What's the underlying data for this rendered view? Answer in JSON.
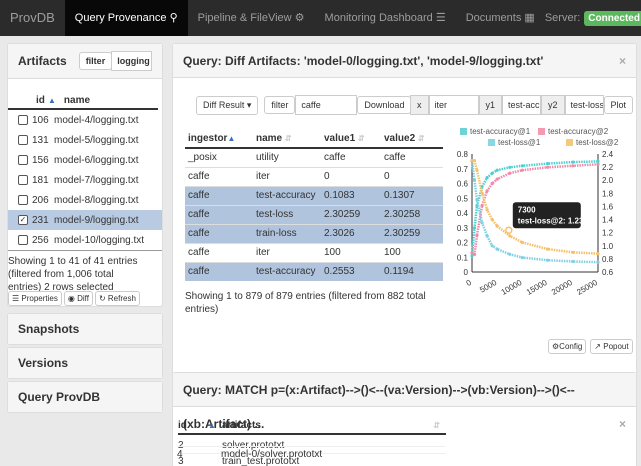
{
  "navbar": {
    "brand": "ProvDB",
    "items": [
      {
        "label": "Query Provenance",
        "icon": "search-icon"
      },
      {
        "label": "Pipeline & FileView",
        "icon": "gear-icon"
      },
      {
        "label": "Monitoring Dashboard",
        "icon": "list-icon"
      },
      {
        "label": "Documents",
        "icon": "document-icon"
      }
    ],
    "server_label": "Server:",
    "server_status": "Connected"
  },
  "sidebar": {
    "artifacts": {
      "title": "Artifacts",
      "filter_label": "filter",
      "filter_value": "logging",
      "col_id": "id",
      "col_name": "name",
      "rows": [
        {
          "id": "106",
          "name": "model-4/logging.txt",
          "checked": false
        },
        {
          "id": "131",
          "name": "model-5/logging.txt",
          "checked": false
        },
        {
          "id": "156",
          "name": "model-6/logging.txt",
          "checked": false
        },
        {
          "id": "181",
          "name": "model-7/logging.txt",
          "checked": false
        },
        {
          "id": "206",
          "name": "model-8/logging.txt",
          "checked": false
        },
        {
          "id": "231",
          "name": "model-9/logging.txt",
          "checked": true
        },
        {
          "id": "256",
          "name": "model-10/logging.txt",
          "checked": false
        }
      ],
      "info_line1": "Showing 1 to 41 of 41 entries",
      "info_line2": "(filtered from 1,006 total",
      "info_line3": "entries)   2 rows selected",
      "btn_properties": "Properties",
      "btn_diff": "Diff",
      "btn_refresh": "Refresh"
    },
    "snapshots": "Snapshots",
    "versions": "Versions",
    "query_provdb": "Query ProvDB"
  },
  "diff_panel": {
    "title": "Query: Diff Artifacts: 'model-0/logging.txt', 'model-9/logging.txt'",
    "toolbar": {
      "diff_result": "Diff Result",
      "filter_label": "filter",
      "filter_value": "caffe",
      "download": "Download",
      "x_label": "x",
      "x_value": "iter",
      "y1_label": "y1",
      "y1_value": "test-acc",
      "y2_label": "y2",
      "y2_value": "test-loss",
      "plot": "Plot"
    },
    "table": {
      "headers": [
        "ingestor",
        "name",
        "value1",
        "value2"
      ],
      "rows": [
        {
          "ingestor": "_posix",
          "name": "utility",
          "value1": "caffe",
          "value2": "caffe",
          "hl": false
        },
        {
          "ingestor": "caffe",
          "name": "iter",
          "value1": "0",
          "value2": "0",
          "hl": false
        },
        {
          "ingestor": "caffe",
          "name": "test-accuracy",
          "value1": "0.1083",
          "value2": "0.1307",
          "hl": true
        },
        {
          "ingestor": "caffe",
          "name": "test-loss",
          "value1": "2.30259",
          "value2": "2.30258",
          "hl": true
        },
        {
          "ingestor": "caffe",
          "name": "train-loss",
          "value1": "2.3026",
          "value2": "2.30259",
          "hl": true
        },
        {
          "ingestor": "caffe",
          "name": "iter",
          "value1": "100",
          "value2": "100",
          "hl": false
        },
        {
          "ingestor": "caffe",
          "name": "test-accuracy",
          "value1": "0.2553",
          "value2": "0.1194",
          "hl": true
        }
      ],
      "info_line1": "Showing 1 to 879 of 879 entries (filtered from 882 total",
      "info_line2": "entries)"
    },
    "config": "Config",
    "popout": "Popout"
  },
  "match_panel": {
    "title": "Query: MATCH p=(x:Artifact)-->()<--(va:Version)-->(vb:Version)-->()<--(xb:Artifact) ...",
    "col_id": "id",
    "col_artifacts": "artifacts",
    "rows": [
      {
        "id": "2",
        "artifact": "solver.prototxt"
      },
      {
        "id": "3",
        "artifact": "train_test.prototxt"
      },
      {
        "id": "4",
        "artifact": "model-0/solver.prototxt"
      }
    ]
  },
  "chart_data": {
    "type": "line",
    "legend": [
      {
        "name": "test-accuracy@1",
        "color": "#6fd3d6"
      },
      {
        "name": "test-accuracy@2",
        "color": "#f19ab0"
      },
      {
        "name": "test-loss@1",
        "color": "#89d7e6"
      },
      {
        "name": "test-loss@2",
        "color": "#f6c87a"
      }
    ],
    "xlim": [
      0,
      25000
    ],
    "x_ticks": [
      "0",
      "5000",
      "10000",
      "15000",
      "20000",
      "25000"
    ],
    "y1lim": [
      0,
      0.8
    ],
    "y1_ticks": [
      "0",
      "0.1",
      "0.2",
      "0.3",
      "0.4",
      "0.5",
      "0.6",
      "0.7",
      "0.8"
    ],
    "y2lim": [
      0.6,
      2.4
    ],
    "y2_ticks": [
      "0.6",
      "0.8",
      "1.0",
      "1.2",
      "1.4",
      "1.6",
      "1.8",
      "2.0",
      "2.2",
      "2.4"
    ],
    "series": [
      {
        "name": "test-accuracy@1",
        "axis": "y1",
        "color": "#4fcfd2",
        "x": [
          0,
          500,
          1000,
          2000,
          3000,
          4000,
          5000,
          7500,
          10000,
          15000,
          20000,
          25000
        ],
        "y": [
          0.11,
          0.3,
          0.45,
          0.58,
          0.64,
          0.67,
          0.69,
          0.71,
          0.72,
          0.735,
          0.745,
          0.75
        ]
      },
      {
        "name": "test-accuracy@2",
        "axis": "y1",
        "color": "#f08aa6",
        "x": [
          0,
          500,
          1000,
          2000,
          3000,
          4000,
          5000,
          7500,
          10000,
          15000,
          20000,
          25000
        ],
        "y": [
          0.13,
          0.12,
          0.25,
          0.45,
          0.55,
          0.6,
          0.63,
          0.67,
          0.69,
          0.71,
          0.72,
          0.73
        ]
      },
      {
        "name": "test-loss@1",
        "axis": "y2",
        "color": "#7fd0e3",
        "x": [
          0,
          500,
          1000,
          2000,
          3000,
          4000,
          5000,
          7500,
          10000,
          15000,
          20000,
          25000
        ],
        "y": [
          2.3,
          2.0,
          1.7,
          1.35,
          1.15,
          1.0,
          0.95,
          0.87,
          0.82,
          0.78,
          0.76,
          0.75
        ]
      },
      {
        "name": "test-loss@2",
        "axis": "y2",
        "color": "#f4c06a",
        "x": [
          0,
          500,
          1000,
          2000,
          3000,
          4000,
          5000,
          7500,
          10000,
          15000,
          20000,
          25000
        ],
        "y": [
          2.3,
          2.3,
          2.15,
          1.8,
          1.55,
          1.4,
          1.3,
          1.15,
          1.05,
          0.95,
          0.9,
          0.88
        ]
      }
    ],
    "tooltip": {
      "line1": "7300",
      "line2": "test-loss@2: 1.2366",
      "x": 7300,
      "y": 1.2366
    }
  }
}
